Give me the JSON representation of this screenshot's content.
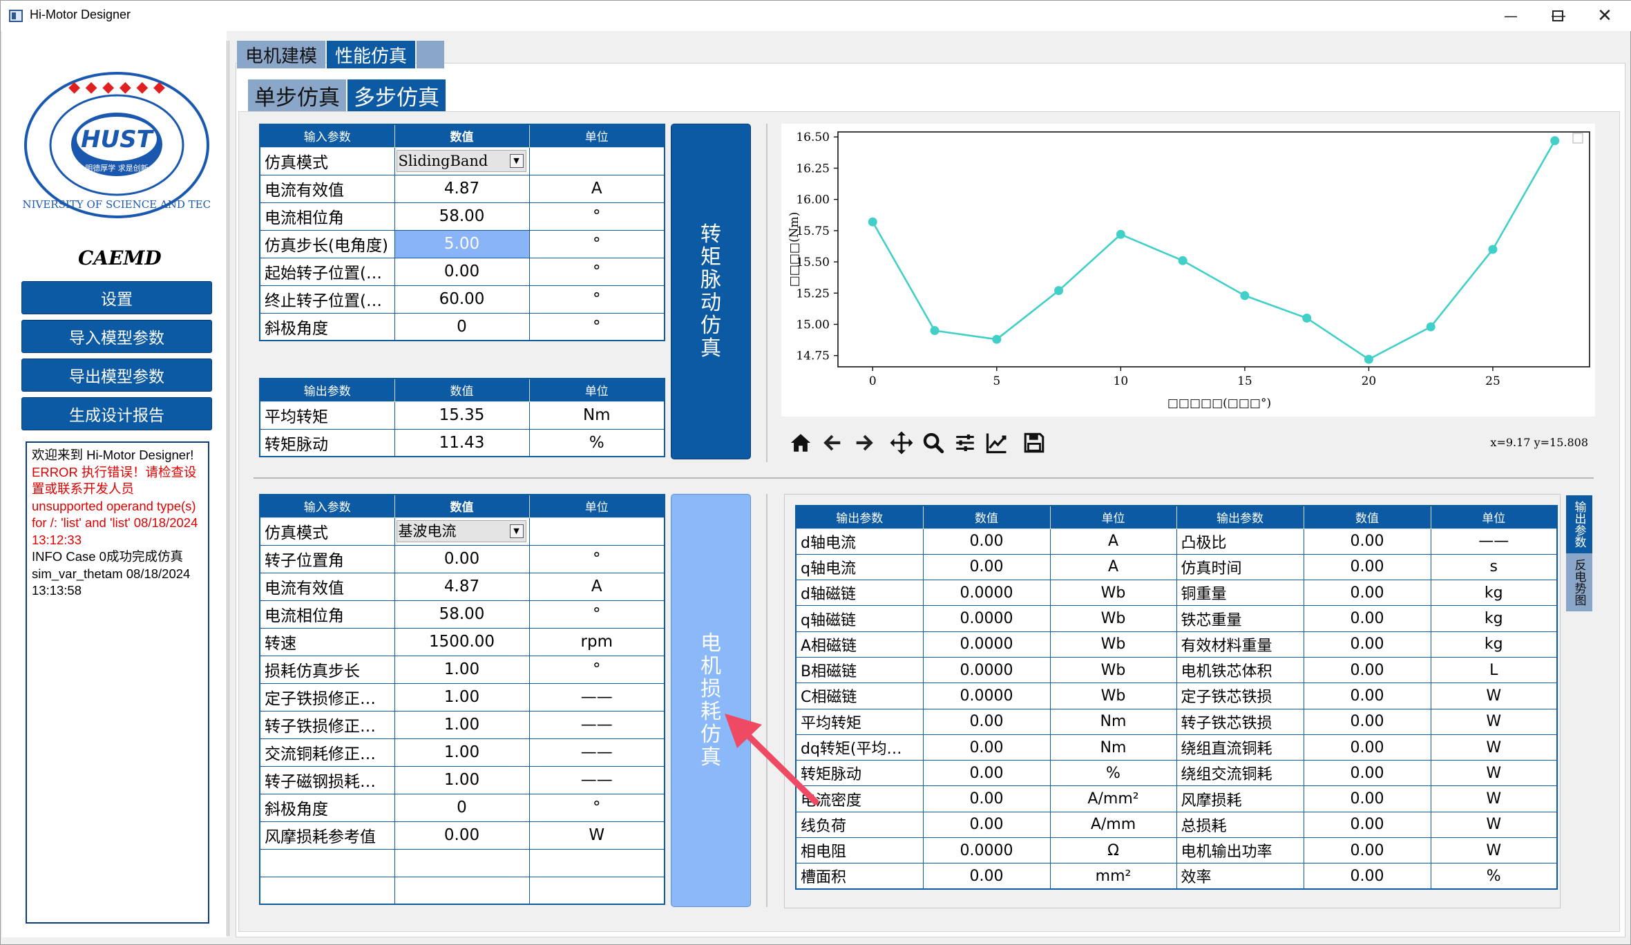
{
  "window": {
    "title": "Hi-Motor Designer"
  },
  "sidebar": {
    "brand": "CAEMD",
    "buttons": [
      "设置",
      "导入模型参数",
      "导出模型参数",
      "生成设计报告"
    ],
    "log": {
      "line1": "欢迎来到 Hi-Motor Designer!",
      "error": "ERROR 执行错误！请检查设置或联系开发人员 unsupported operand type(s) for /: 'list' and 'list' 08/18/2024 13:12:33",
      "info": "INFO Case 0成功完成仿真 sim_var_thetam 08/18/2024 13:13:58"
    }
  },
  "tabs": {
    "main": [
      "电机建模",
      "性能仿真"
    ],
    "sub": [
      "单步仿真",
      "多步仿真"
    ]
  },
  "torque_input": {
    "headers": [
      "输入参数",
      "数值",
      "单位"
    ],
    "rows": [
      {
        "name": "仿真模式",
        "value": "SlidingBand",
        "unit": ""
      },
      {
        "name": "电流有效值",
        "value": "4.87",
        "unit": "A"
      },
      {
        "name": "电流相位角",
        "value": "58.00",
        "unit": "°"
      },
      {
        "name": "仿真步长(电角度)",
        "value": "5.00",
        "unit": "°"
      },
      {
        "name": "起始转子位置(…",
        "value": "0.00",
        "unit": "°"
      },
      {
        "name": "终止转子位置(…",
        "value": "60.00",
        "unit": "°"
      },
      {
        "name": "斜极角度",
        "value": "0",
        "unit": "°"
      }
    ]
  },
  "torque_output": {
    "headers": [
      "输出参数",
      "数值",
      "单位"
    ],
    "rows": [
      {
        "name": "平均转矩",
        "value": "15.35",
        "unit": "Nm"
      },
      {
        "name": "转矩脉动",
        "value": "11.43",
        "unit": "%"
      }
    ]
  },
  "torque_button": [
    "转",
    "矩",
    "脉",
    "动",
    "仿",
    "真"
  ],
  "loss_button": [
    "电",
    "机",
    "损",
    "耗",
    "仿",
    "真"
  ],
  "loss_input": {
    "headers": [
      "输入参数",
      "数值",
      "单位"
    ],
    "rows": [
      {
        "name": "仿真模式",
        "value": "基波电流",
        "unit": ""
      },
      {
        "name": "转子位置角",
        "value": "0.00",
        "unit": "°"
      },
      {
        "name": "电流有效值",
        "value": "4.87",
        "unit": "A"
      },
      {
        "name": "电流相位角",
        "value": "58.00",
        "unit": "°"
      },
      {
        "name": "转速",
        "value": "1500.00",
        "unit": "rpm"
      },
      {
        "name": "损耗仿真步长",
        "value": "1.00",
        "unit": "°"
      },
      {
        "name": "定子铁损修正…",
        "value": "1.00",
        "unit": "——"
      },
      {
        "name": "转子铁损修正…",
        "value": "1.00",
        "unit": "——"
      },
      {
        "name": "交流铜耗修正…",
        "value": "1.00",
        "unit": "——"
      },
      {
        "name": "转子磁钢损耗…",
        "value": "1.00",
        "unit": "——"
      },
      {
        "name": "斜极角度",
        "value": "0",
        "unit": "°"
      },
      {
        "name": "风摩损耗参考值",
        "value": "0.00",
        "unit": "W"
      },
      {
        "name": "",
        "value": "",
        "unit": ""
      },
      {
        "name": "",
        "value": "",
        "unit": ""
      }
    ]
  },
  "loss_output": {
    "headers": [
      "输出参数",
      "数值",
      "单位",
      "输出参数",
      "数值",
      "单位"
    ],
    "rows": [
      [
        "d轴电流",
        "0.00",
        "A",
        "凸极比",
        "0.00",
        "——"
      ],
      [
        "q轴电流",
        "0.00",
        "A",
        "仿真时间",
        "0.00",
        "s"
      ],
      [
        "d轴磁链",
        "0.0000",
        "Wb",
        "铜重量",
        "0.00",
        "kg"
      ],
      [
        "q轴磁链",
        "0.0000",
        "Wb",
        "铁芯重量",
        "0.00",
        "kg"
      ],
      [
        "A相磁链",
        "0.0000",
        "Wb",
        "有效材料重量",
        "0.00",
        "kg"
      ],
      [
        "B相磁链",
        "0.0000",
        "Wb",
        "电机铁芯体积",
        "0.00",
        "L"
      ],
      [
        "C相磁链",
        "0.0000",
        "Wb",
        "定子铁芯铁损",
        "0.00",
        "W"
      ],
      [
        "平均转矩",
        "0.00",
        "Nm",
        "转子铁芯铁损",
        "0.00",
        "W"
      ],
      [
        "dq转矩(平均…",
        "0.00",
        "Nm",
        "绕组直流铜耗",
        "0.00",
        "W"
      ],
      [
        "转矩脉动",
        "0.00",
        "%",
        "绕组交流铜耗",
        "0.00",
        "W"
      ],
      [
        "电流密度",
        "0.00",
        "A/mm²",
        "风摩损耗",
        "0.00",
        "W"
      ],
      [
        "线负荷",
        "0.00",
        "A/mm",
        "总损耗",
        "0.00",
        "W"
      ],
      [
        "相电阻",
        "0.0000",
        "Ω",
        "电机输出功率",
        "0.00",
        "W"
      ],
      [
        "槽面积",
        "0.00",
        "mm²",
        "效率",
        "0.00",
        "%"
      ]
    ]
  },
  "side_tabs": [
    "输出参数",
    "反电势图"
  ],
  "plot": {
    "coord_readout": "x=9.17 y=15.808",
    "toolbar": [
      "home-icon",
      "back-icon",
      "forward-icon",
      "pan-icon",
      "zoom-icon",
      "configure-icon",
      "edit-curve-icon",
      "save-icon"
    ]
  },
  "chart_data": {
    "type": "line",
    "x": [
      0,
      2.5,
      5,
      7.5,
      10,
      12.5,
      15,
      17.5,
      20,
      22.5,
      25,
      27.5
    ],
    "y": [
      15.82,
      14.95,
      14.88,
      15.27,
      15.72,
      15.51,
      15.23,
      15.05,
      14.72,
      14.98,
      15.6,
      16.47
    ],
    "xlim": [
      -1.4,
      28.9
    ],
    "ylim": [
      14.66,
      16.54
    ],
    "xticks": [
      "0",
      "5",
      "10",
      "15",
      "20",
      "25"
    ],
    "yticks": [
      "16.50",
      "16.25",
      "16.00",
      "15.75",
      "15.50",
      "15.25",
      "15.00",
      "14.75"
    ],
    "xlabel": "□□□□□(□□□°)",
    "ylabel": "□□□□(Nm)",
    "color": "#40d0c8",
    "grid": false
  }
}
